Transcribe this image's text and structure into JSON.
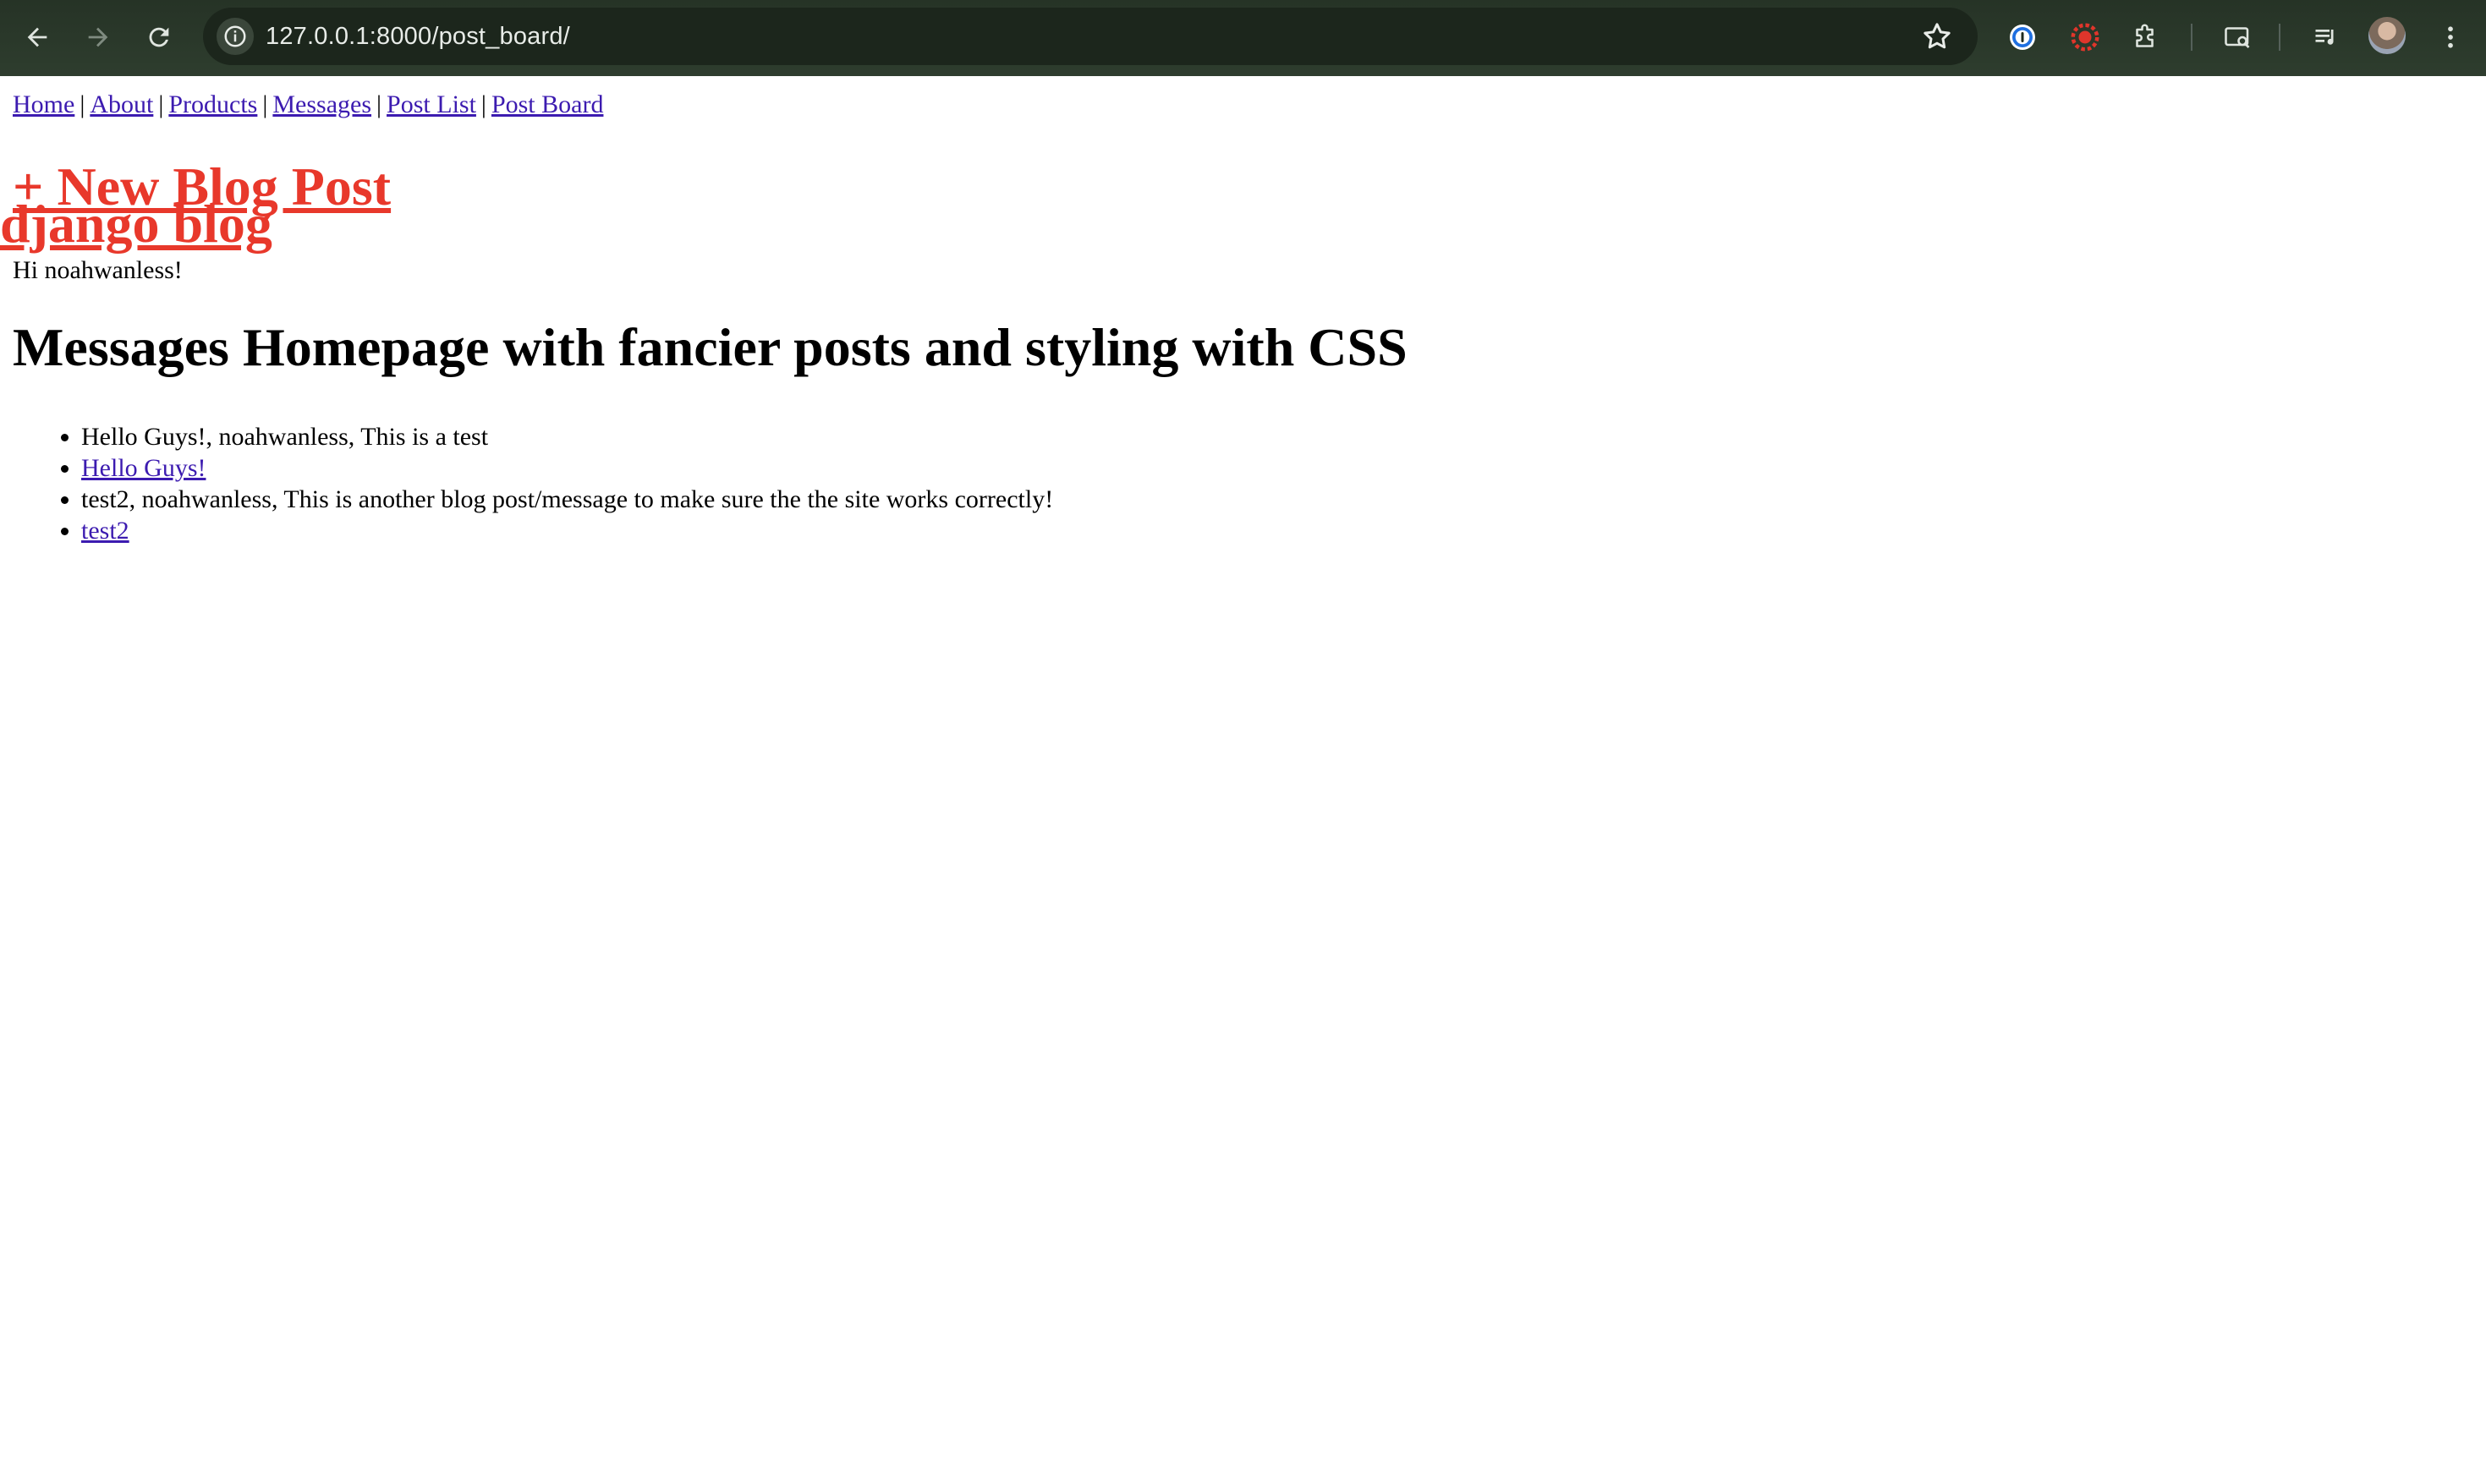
{
  "browser": {
    "url": "127.0.0.1:8000/post_board/",
    "icons": {
      "back": "arrow-left-icon",
      "forward": "arrow-right-icon",
      "reload": "reload-icon",
      "site_info": "info-icon",
      "bookmark": "star-icon",
      "password_manager": "1password-icon",
      "extension_red": "red-extension-icon",
      "extensions": "puzzle-icon",
      "cast": "cast-icon",
      "media": "media-controls-icon",
      "profile": "avatar",
      "menu": "kebab-menu-icon"
    },
    "colors": {
      "frame": "#2b3a2b",
      "omnibox": "#1c261c",
      "url_text": "#e8ece8"
    }
  },
  "nav": {
    "links": [
      "Home",
      "About",
      "Products",
      "Messages",
      "Post List",
      "Post Board"
    ],
    "separator": "|"
  },
  "header": {
    "new_post_label": "+ New Blog Post",
    "blog_title": "django blog",
    "greeting": "Hi noahwanless!",
    "accent_color": "#e8382b"
  },
  "main": {
    "heading": "Messages Homepage with fancier posts and styling with CSS",
    "posts": [
      {
        "summary": "Hello Guys!, noahwanless, This is a test",
        "link": "Hello Guys!"
      },
      {
        "summary": "test2, noahwanless, This is another blog post/message to make sure the the site works correctly!",
        "link": "test2"
      }
    ],
    "link_color": "#3c1bb0"
  }
}
